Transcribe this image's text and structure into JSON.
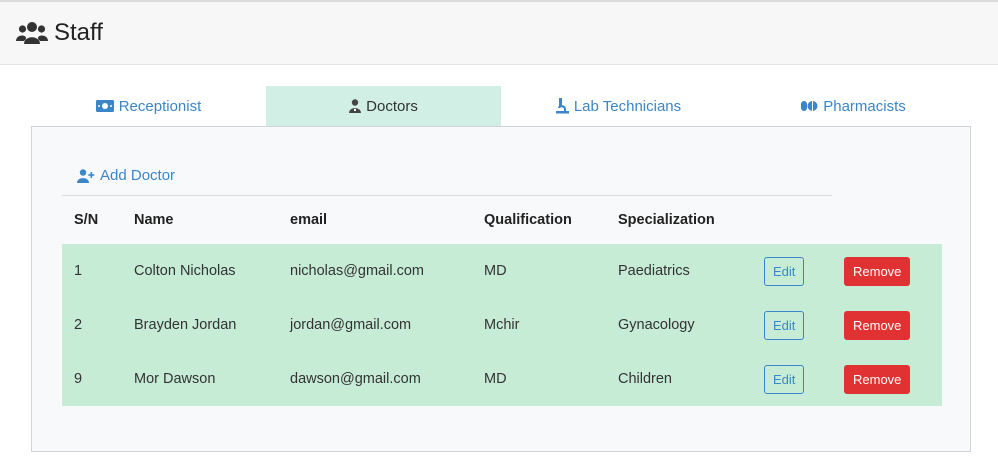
{
  "header": {
    "title": "Staff",
    "icon": "users-icon"
  },
  "tabs": [
    {
      "label": "Receptionist",
      "icon": "id-card-icon",
      "active": false
    },
    {
      "label": "Doctors",
      "icon": "user-doctor-icon",
      "active": true
    },
    {
      "label": "Lab Technicians",
      "icon": "microscope-icon",
      "active": false
    },
    {
      "label": "Pharmacists",
      "icon": "pills-icon",
      "active": false
    }
  ],
  "panel": {
    "add_label": "Add Doctor",
    "add_icon": "user-plus-icon",
    "table": {
      "headers": [
        "S/N",
        "Name",
        "email",
        "Qualification",
        "Specialization"
      ],
      "rows": [
        {
          "sn": "1",
          "name": "Colton Nicholas",
          "email": "nicholas@gmail.com",
          "qualification": "MD",
          "specialization": "Paediatrics",
          "edit": "Edit",
          "remove": "Remove"
        },
        {
          "sn": "2",
          "name": "Brayden Jordan",
          "email": "jordan@gmail.com",
          "qualification": "Mchir",
          "specialization": "Gynacology",
          "edit": "Edit",
          "remove": "Remove"
        },
        {
          "sn": "9",
          "name": "Mor Dawson",
          "email": "dawson@gmail.com",
          "qualification": "MD",
          "specialization": "Children",
          "edit": "Edit",
          "remove": "Remove"
        }
      ]
    }
  },
  "colors": {
    "link": "#3b86c8",
    "row_bg": "#c6ecd6",
    "active_tab_bg": "#d1efe5",
    "danger": "#e03232"
  }
}
